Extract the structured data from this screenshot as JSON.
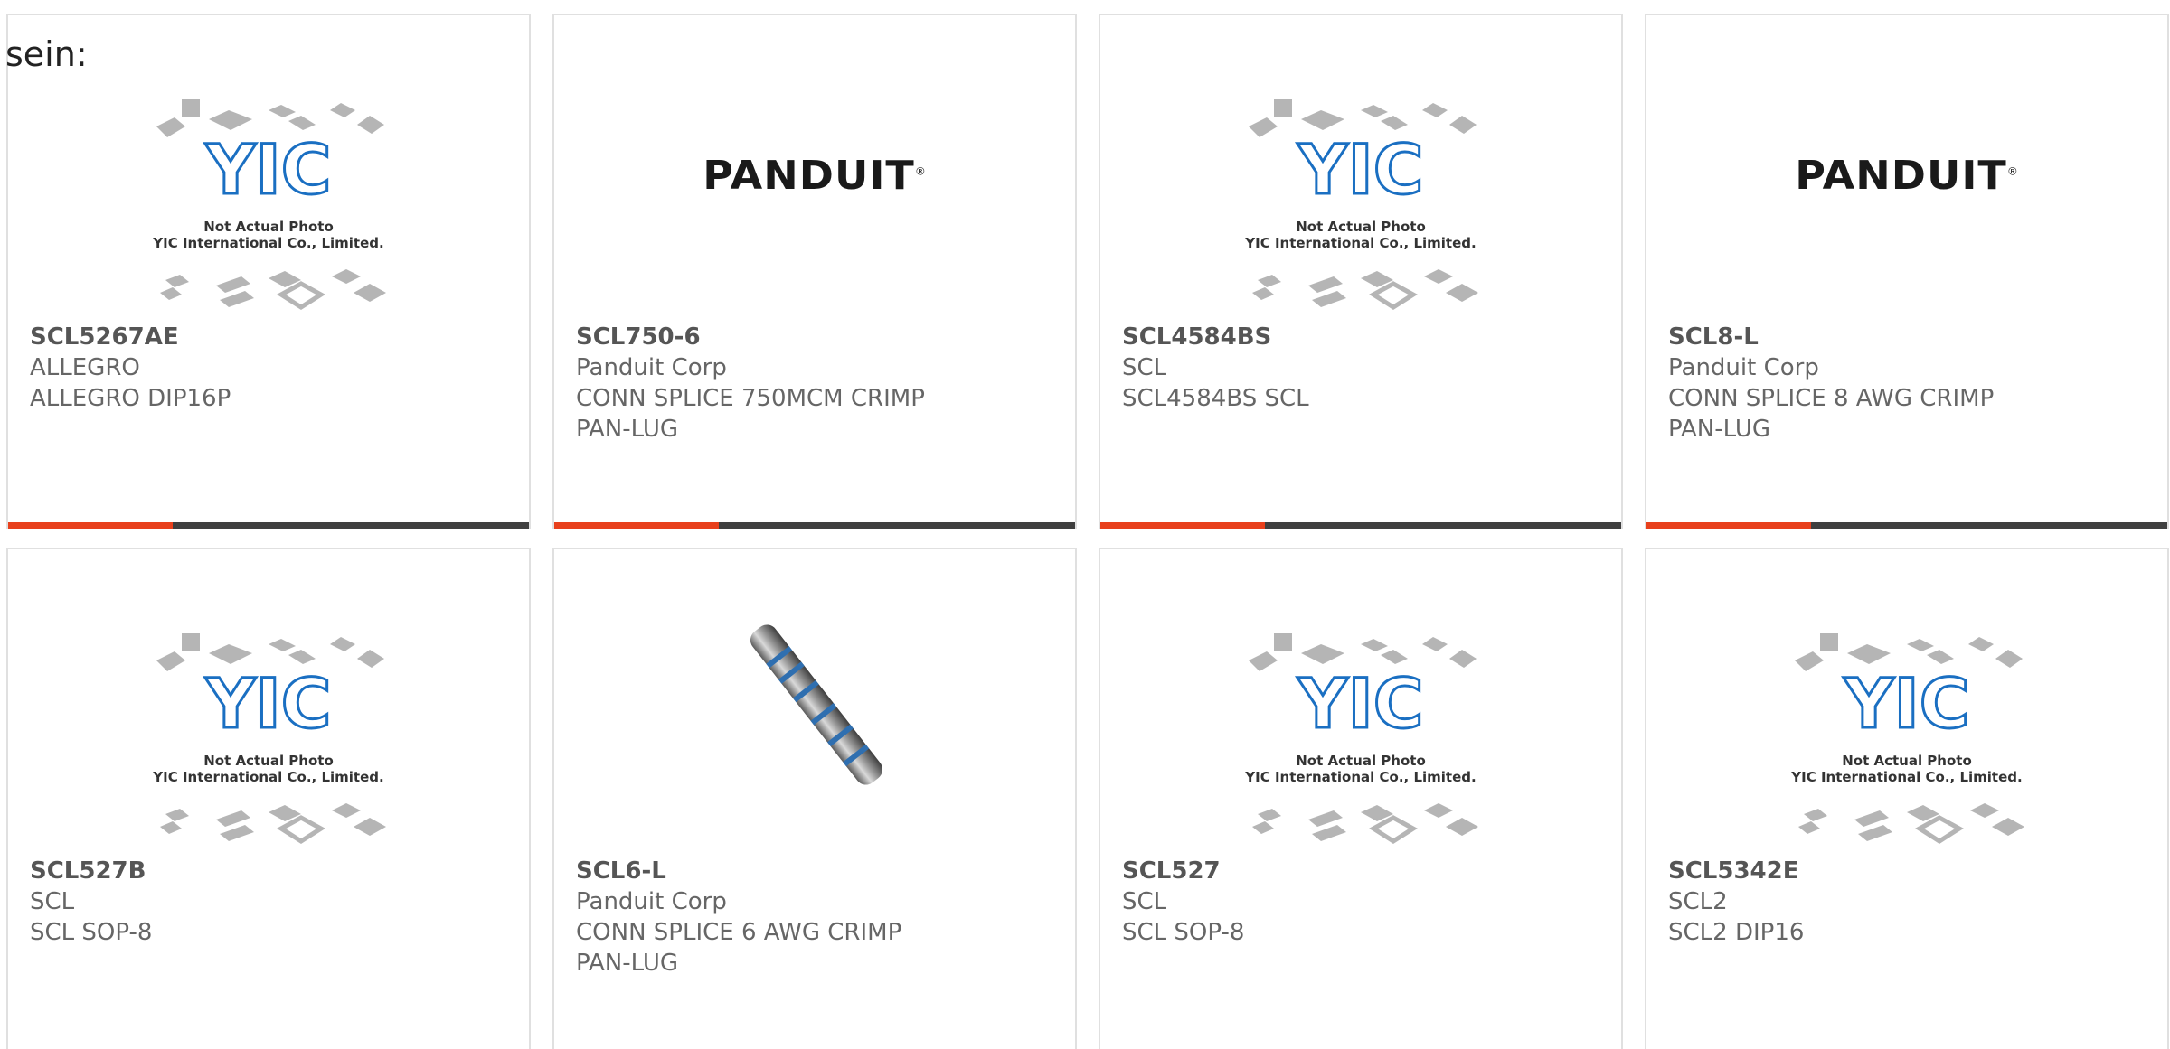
{
  "page": {
    "intro_text": "sein:"
  },
  "placeholder": {
    "line1": "Not Actual Photo",
    "line2": "YIC International Co., Limited.",
    "logo_text": "YIC"
  },
  "brand_logo": {
    "panduit": "PANDUIT"
  },
  "colors": {
    "accent": "#e8401c",
    "bar": "#3f3f3f",
    "yic_blue": "#1a6fc2"
  },
  "products": [
    {
      "part": "SCL5267AE",
      "maker": "ALLEGRO",
      "desc": "ALLEGRO DIP16P",
      "desc2": "",
      "image": "yic-placeholder"
    },
    {
      "part": "SCL750-6",
      "maker": "Panduit Corp",
      "desc": "CONN SPLICE 750MCM CRIMP",
      "desc2": "PAN-LUG",
      "image": "panduit-logo"
    },
    {
      "part": "SCL4584BS",
      "maker": "SCL",
      "desc": "SCL4584BS SCL",
      "desc2": "",
      "image": "yic-placeholder"
    },
    {
      "part": "SCL8-L",
      "maker": "Panduit Corp",
      "desc": "CONN SPLICE 8 AWG CRIMP",
      "desc2": "PAN-LUG",
      "image": "panduit-logo"
    },
    {
      "part": "SCL527B",
      "maker": "SCL",
      "desc": "SCL SOP-8",
      "desc2": "",
      "image": "yic-placeholder"
    },
    {
      "part": "SCL6-L",
      "maker": "Panduit Corp",
      "desc": "CONN SPLICE 6 AWG CRIMP",
      "desc2": "PAN-LUG",
      "image": "splice-photo"
    },
    {
      "part": "SCL527",
      "maker": "SCL",
      "desc": "SCL SOP-8",
      "desc2": "",
      "image": "yic-placeholder"
    },
    {
      "part": "SCL5342E",
      "maker": "SCL2",
      "desc": "SCL2 DIP16",
      "desc2": "",
      "image": "yic-placeholder"
    }
  ]
}
